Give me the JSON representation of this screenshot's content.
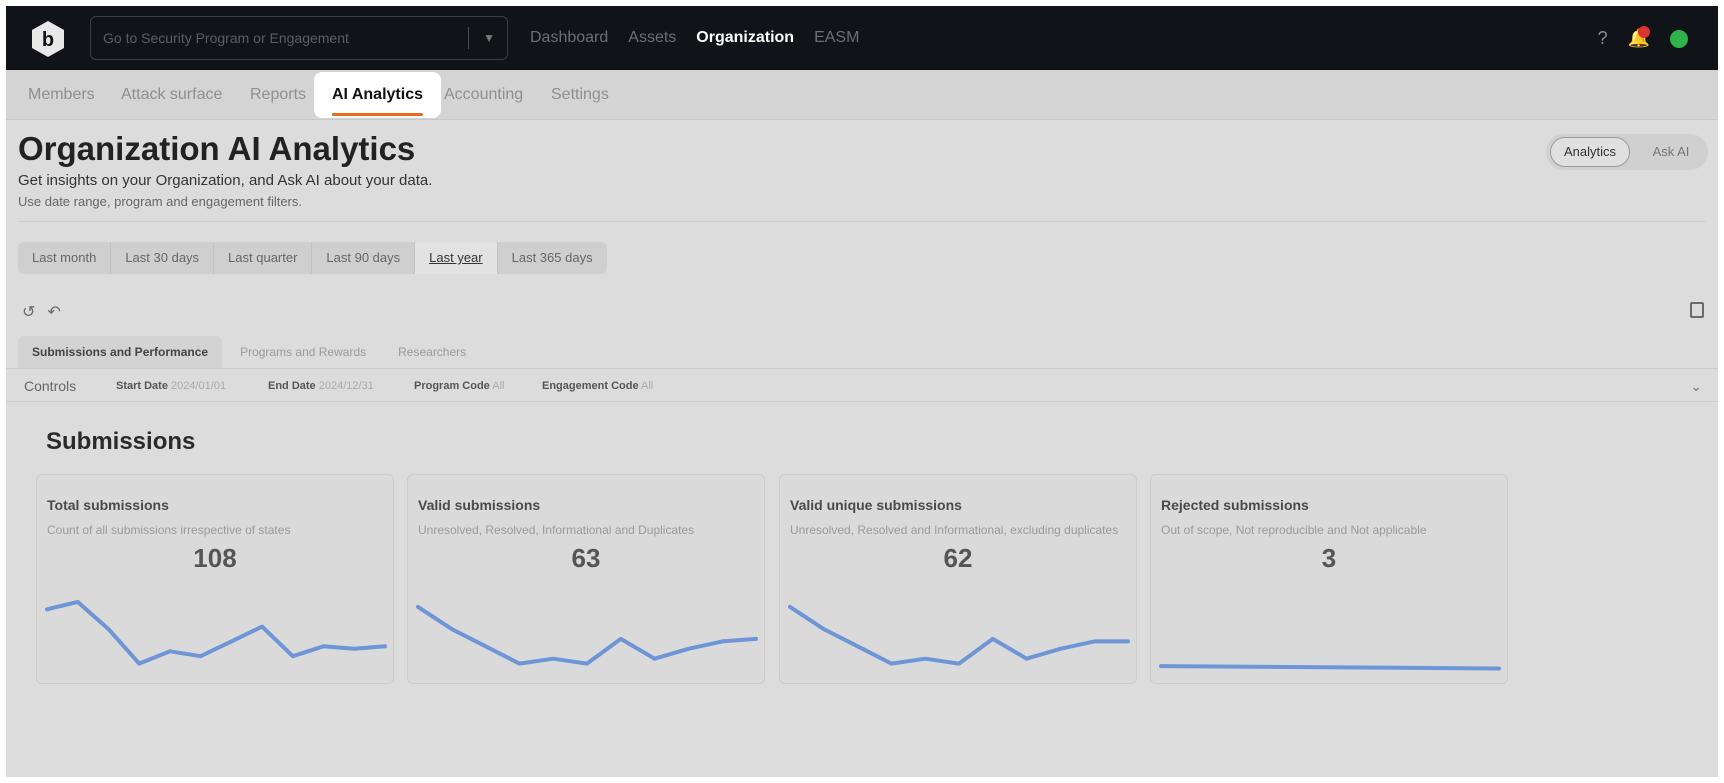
{
  "topbar": {
    "search_placeholder": "Go to Security Program or Engagement",
    "nav": [
      "Dashboard",
      "Assets",
      "Organization",
      "EASM"
    ],
    "active_nav": "Organization"
  },
  "subnav": {
    "tabs": [
      "Members",
      "Attack surface",
      "Reports",
      "AI Analytics",
      "Accounting",
      "Settings"
    ],
    "active": "AI Analytics"
  },
  "page": {
    "title": "Organization AI Analytics",
    "subtitle": "Get insights on your Organization, and Ask AI about your data.",
    "hint": "Use date range, program and engagement filters."
  },
  "mode_toggle": {
    "analytics": "Analytics",
    "ask_ai": "Ask AI",
    "selected": "Analytics"
  },
  "date_ranges": [
    "Last month",
    "Last 30 days",
    "Last quarter",
    "Last 90 days",
    "Last year",
    "Last 365 days"
  ],
  "selected_range": "Last year",
  "section_tabs": [
    "Submissions and Performance",
    "Programs and Rewards",
    "Researchers"
  ],
  "active_section": "Submissions and Performance",
  "controls": {
    "label": "Controls",
    "start_label": "Start Date",
    "start_value": "2024/01/01",
    "end_label": "End Date",
    "end_value": "2024/12/31",
    "program_label": "Program Code",
    "program_value": "All",
    "engagement_label": "Engagement Code",
    "engagement_value": "All"
  },
  "submissions": {
    "title": "Submissions",
    "cards": [
      {
        "title": "Total submissions",
        "desc": "Count of all submissions irrespective of states",
        "value": "108",
        "trend": [
          25,
          28,
          17,
          3,
          8,
          6,
          12,
          18,
          6,
          10,
          9,
          10
        ]
      },
      {
        "title": "Valid submissions",
        "desc": "Unresolved, Resolved, Informational and Duplicates",
        "value": "63",
        "trend": [
          26,
          17,
          10,
          3,
          5,
          3,
          13,
          5,
          9,
          12,
          13
        ]
      },
      {
        "title": "Valid unique submissions",
        "desc": "Unresolved, Resolved and Informational, excluding duplicates",
        "value": "62",
        "trend": [
          26,
          17,
          10,
          3,
          5,
          3,
          13,
          5,
          9,
          12,
          12
        ]
      },
      {
        "title": "Rejected submissions",
        "desc": "Out of scope, Not reproducible and Not applicable",
        "value": "3",
        "trend": [
          2,
          1
        ]
      }
    ]
  },
  "colors": {
    "accent": "#e86a1a",
    "sparkline": "#6e95d6",
    "topbar": "#101317"
  }
}
